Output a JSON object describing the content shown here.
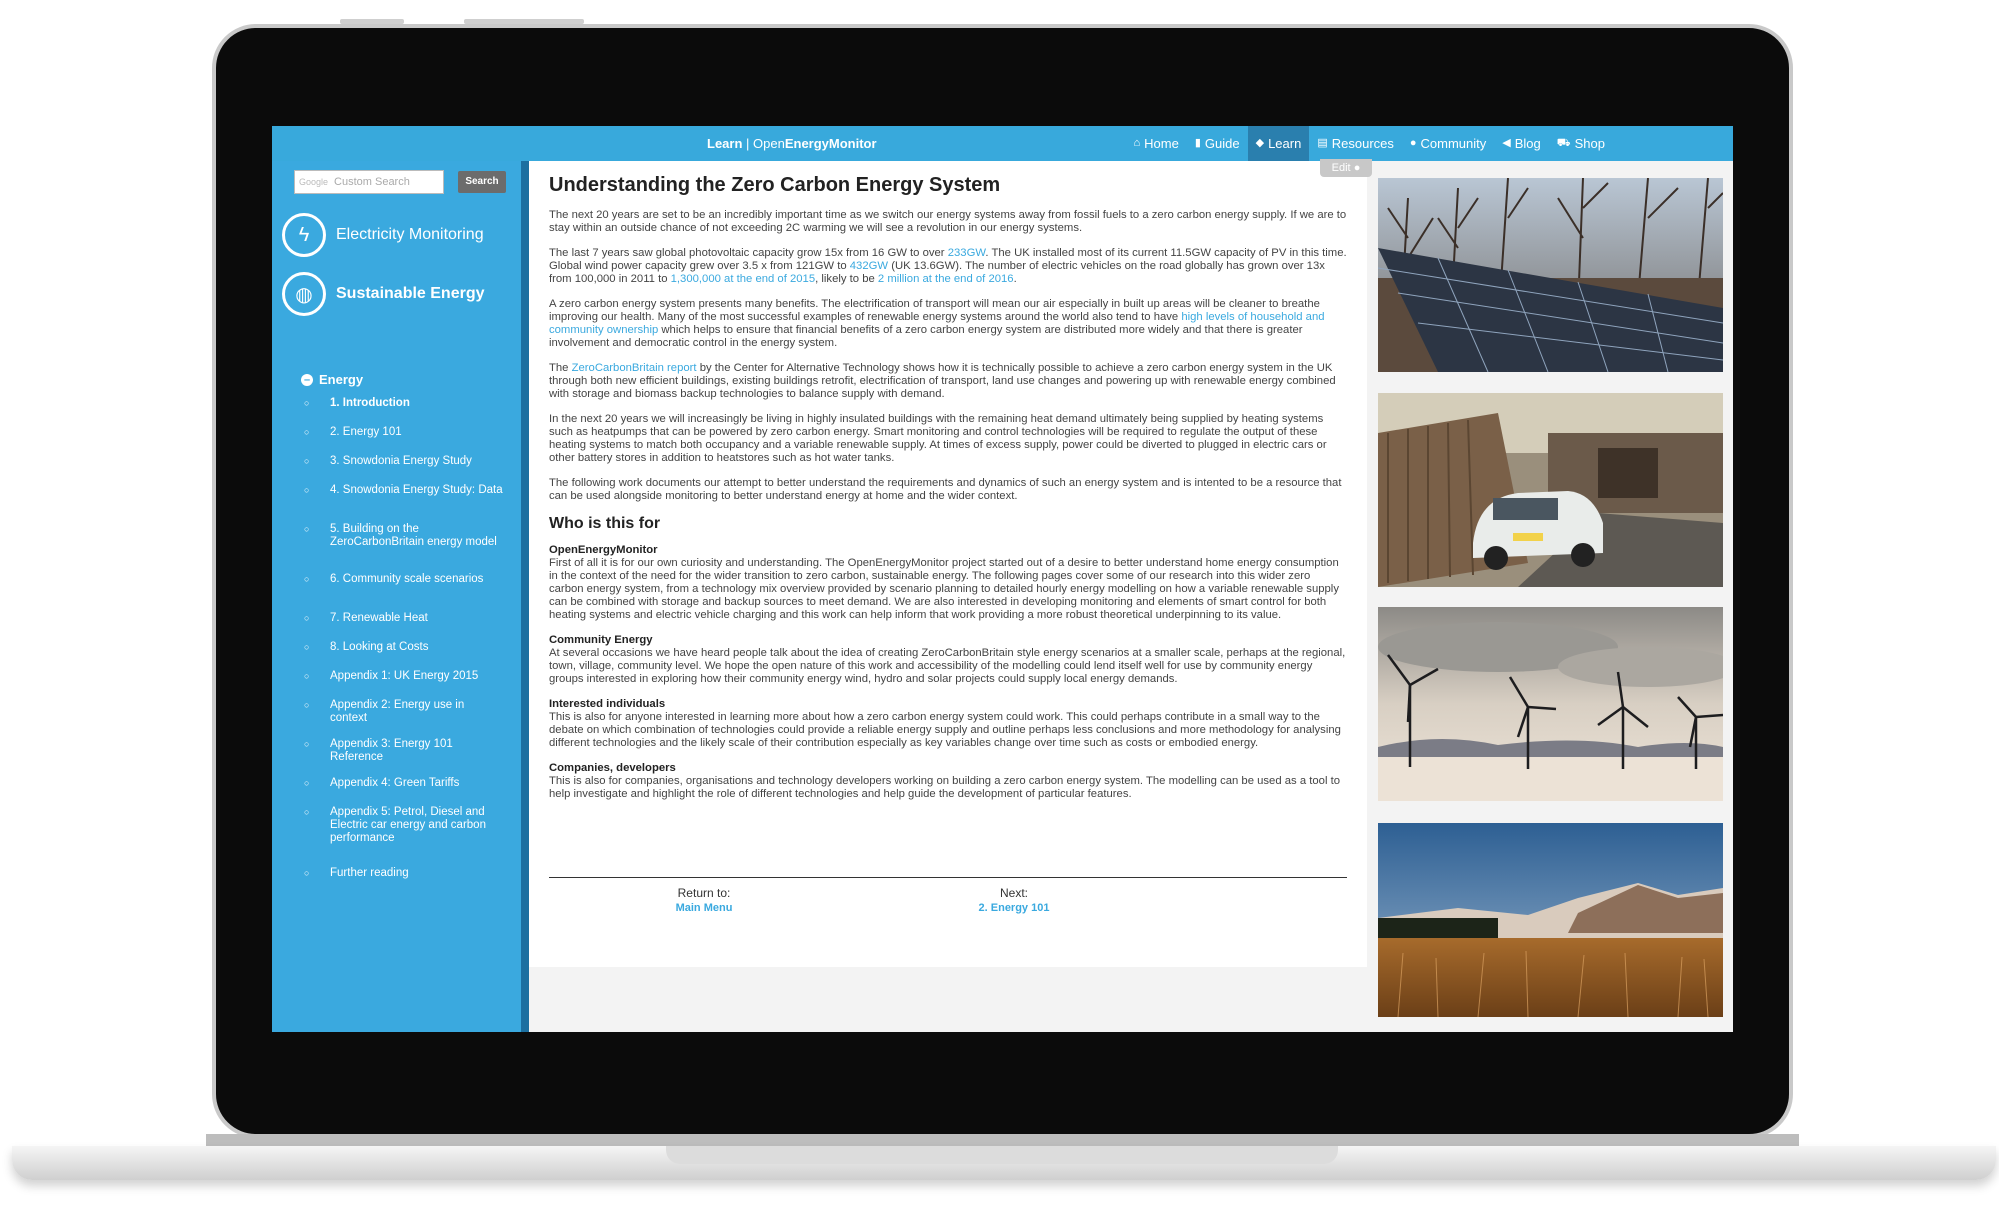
{
  "navbar": {
    "brand_section": "Learn",
    "brand_sep": " | ",
    "brand_open": "Open",
    "brand_name": "EnergyMonitor",
    "items": [
      {
        "icon": "home-icon",
        "glyph": "⌂",
        "label": "Home"
      },
      {
        "icon": "book-icon",
        "glyph": "▮",
        "label": "Guide"
      },
      {
        "icon": "graduation-cap-icon",
        "glyph": "◆",
        "label": "Learn",
        "active": true
      },
      {
        "icon": "resources-icon",
        "glyph": "▤",
        "label": "Resources"
      },
      {
        "icon": "comments-icon",
        "glyph": "●",
        "label": "Community"
      },
      {
        "icon": "bullhorn-icon",
        "glyph": "◀",
        "label": "Blog"
      },
      {
        "icon": "cart-icon",
        "glyph": "⛟",
        "label": "Shop"
      }
    ]
  },
  "sidebar": {
    "search_brand": "Google",
    "search_placeholder": "Custom Search",
    "search_button": "Search",
    "categories": [
      {
        "label": "Electricity Monitoring",
        "icon": "bolt-icon",
        "glyph": "ϟ"
      },
      {
        "label": "Sustainable Energy",
        "icon": "globe-icon",
        "glyph": "◍"
      }
    ],
    "section": "Energy",
    "toc": [
      {
        "label": "1. Introduction"
      },
      {
        "label": "2. Energy 101"
      },
      {
        "label": "3. Snowdonia Energy Study"
      },
      {
        "label": "4. Snowdonia Energy Study: Data"
      },
      {
        "label": "5. Building on the ZeroCarbonBritain energy model"
      },
      {
        "label": "6. Community scale scenarios"
      },
      {
        "label": "7. Renewable Heat"
      },
      {
        "label": "8. Looking at Costs"
      },
      {
        "label": "Appendix 1: UK Energy 2015"
      },
      {
        "label": "Appendix 2: Energy use in context"
      },
      {
        "label": "Appendix 3: Energy 101 Reference"
      },
      {
        "label": "Appendix 4: Green Tariffs"
      },
      {
        "label": "Appendix 5: Petrol, Diesel and Electric car energy and carbon performance"
      },
      {
        "label": "Further reading"
      }
    ]
  },
  "content": {
    "edit_label": "Edit",
    "title": "Understanding the Zero Carbon Energy System",
    "p1": "The next 20 years are set to be an incredibly important time as we switch our energy systems away from fossil fuels to a zero carbon energy supply. If we are to stay within an outside chance of not exceeding 2C warming we will see a revolution in our energy systems.",
    "p2": {
      "a": "The last 7 years saw global photovoltaic capacity grow 15x from 16 GW to over ",
      "l1": "233GW",
      "b": ". The UK installed most of its current 11.5GW capacity of PV in this time. Global wind power capacity grew over 3.5 x from 121GW to ",
      "l2": "432GW",
      "c": " (UK 13.6GW). The number of electric vehicles on the road globally has grown over 13x from 100,000 in 2011 to ",
      "l3": "1,300,000 at the end of 2015",
      "d": ", likely to be ",
      "l4": "2 million at the end of 2016",
      "e": "."
    },
    "p3": {
      "a": "A zero carbon energy system presents many benefits. The electrification of transport will mean our air especially in built up areas will be cleaner to breathe improving our health. Many of the most successful examples of renewable energy systems around the world also tend to have ",
      "l1": "high levels of household and community ownership",
      "b": " which helps to ensure that financial benefits of a zero carbon energy system are distributed more widely and that there is greater involvement and democratic control in the energy system."
    },
    "p4": {
      "a": "The ",
      "l1": "ZeroCarbonBritain report",
      "b": " by the Center for Alternative Technology shows how it is technically possible to achieve a zero carbon energy system in the UK through both new efficient buildings, existing buildings retrofit, electrification of transport, land use changes and powering up with renewable energy combined with storage and biomass backup technologies to balance supply with demand."
    },
    "p5": "In the next 20 years we will increasingly be living in highly insulated buildings with the remaining heat demand ultimately being supplied by heating systems such as heatpumps that can be powered by zero carbon energy. Smart monitoring and control technologies will be required to regulate the output of these heating systems to match both occupancy and a variable renewable supply. At times of excess supply, power could be diverted to plugged in electric cars or other battery stores in addition to heatstores such as hot water tanks.",
    "p6": "The following work documents our attempt to better understand the requirements and dynamics of such an energy system and is intented to be a resource that can be used alongside monitoring to better understand energy at home and the wider context.",
    "h2": "Who is this for",
    "sections": [
      {
        "heading": "OpenEnergyMonitor",
        "text": "First of all it is for our own curiosity and understanding. The OpenEnergyMonitor project started out of a desire to better understand home energy consumption in the context of the need for the wider transition to zero carbon, sustainable energy. The following pages cover some of our research into this wider zero carbon energy system, from a technology mix overview provided by scenario planning to detailed hourly energy modelling on how a variable renewable supply can be combined with storage and backup sources to meet demand. We are also interested in developing monitoring and elements of smart control for both heating systems and electric vehicle charging and this work can help inform that work providing a more robust theoretical underpinning to its value."
      },
      {
        "heading": "Community Energy",
        "text": "At several occasions we have heard people talk about the idea of creating ZeroCarbonBritain style energy scenarios at a smaller scale, perhaps at the regional, town, village, community level. We hope the open nature of this work and accessibility of the modelling could lend itself well for use by community energy groups interested in exploring how their community energy wind, hydro and solar projects could supply local energy demands."
      },
      {
        "heading": "Interested individuals",
        "text": "This is also for anyone interested in learning more about how a zero carbon energy system could work. This could perhaps contribute in a small way to the debate on which combination of technologies could provide a reliable energy supply and outline perhaps less conclusions and more methodology for analysing different technologies and the likely scale of their contribution especially as key variables change over time such as costs or embodied energy."
      },
      {
        "heading": "Companies, developers",
        "text": "This is also for companies, organisations and technology developers working on building a zero carbon energy system. The modelling can be used as a tool to help investigate and highlight the role of different technologies and help guide the development of particular features."
      }
    ],
    "footer": {
      "return_label": "Return to:",
      "return_link": "Main Menu",
      "next_label": "Next:",
      "next_link": "2. Energy 101"
    }
  },
  "colors": {
    "accent": "#38a9dc",
    "active_nav": "#2a7fae",
    "link": "#3aa9df"
  }
}
